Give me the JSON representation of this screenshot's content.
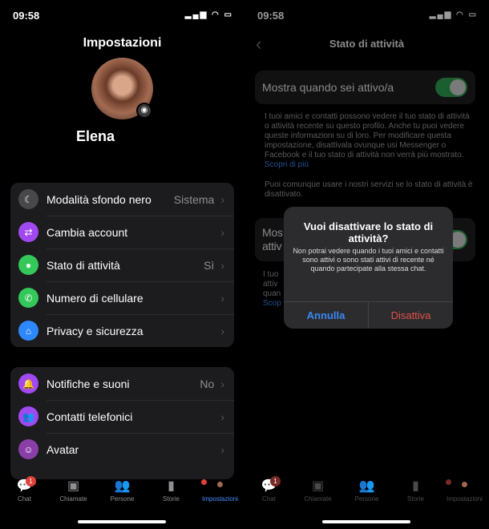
{
  "status": {
    "time": "09:58",
    "icons": "▂▄▆ ◠ ▭"
  },
  "left": {
    "title": "Impostazioni",
    "profile_name": "Elena",
    "group1": [
      {
        "label": "Modalità sfondo nero",
        "value": "Sistema",
        "icon": "moon-icon",
        "color": "#48484a",
        "glyph": "☾"
      },
      {
        "label": "Cambia account",
        "value": "",
        "icon": "switch-account-icon",
        "color": "#a149f1",
        "glyph": "⇄"
      },
      {
        "label": "Stato di attività",
        "value": "Sì",
        "icon": "active-status-icon",
        "color": "#34c759",
        "glyph": "●"
      },
      {
        "label": "Numero di cellulare",
        "value": "",
        "icon": "phone-icon",
        "color": "#34c759",
        "glyph": "✆"
      },
      {
        "label": "Privacy e sicurezza",
        "value": "",
        "icon": "home-shield-icon",
        "color": "#2d88ff",
        "glyph": "⌂"
      }
    ],
    "group2": [
      {
        "label": "Notifiche e suoni",
        "value": "No",
        "icon": "bell-icon",
        "color": "#a149f1",
        "glyph": "🔔"
      },
      {
        "label": "Contatti telefonici",
        "value": "",
        "icon": "contacts-icon",
        "color": "#a149f1",
        "glyph": "👥"
      },
      {
        "label": "Avatar",
        "value": "",
        "icon": "avatar-icon",
        "color": "#8a3fa8",
        "glyph": "☺"
      }
    ]
  },
  "tabs": [
    {
      "label": "Chat",
      "icon": "chat-icon",
      "glyph": "💬",
      "badge": "1"
    },
    {
      "label": "Chiamate",
      "icon": "video-icon",
      "glyph": "▣"
    },
    {
      "label": "Persone",
      "icon": "people-icon",
      "glyph": "👥"
    },
    {
      "label": "Storie",
      "icon": "stories-icon",
      "glyph": "▮"
    },
    {
      "label": "Impostazioni",
      "icon": "profile-icon",
      "glyph": "●"
    }
  ],
  "right": {
    "title": "Stato di attività",
    "row1": "Mostra quando sei attivo/a",
    "footer1": "I tuoi amici e contatti possono vedere il tuo stato di attività o attività recente su questo profilo. Anche tu puoi vedere queste informazioni su di loro. Per modificare questa impostazione, disattivala ovunque usi Messenger o Facebook e il tuo stato di attività non verrà più mostrato.",
    "footer1_link": "Scopri di più",
    "footer2": "Puoi comunque usare i nostri servizi se lo stato di attività è disattivato.",
    "row2_partial": "Mos attiv",
    "footer3_partial": "I tuo attiv quan",
    "footer3_link_partial": "Scop",
    "dialog": {
      "title": "Vuoi disattivare lo stato di attività?",
      "message": "Non potrai vedere quando i tuoi amici e contatti sono attivi o sono stati attivi di recente né quando partecipate alla stessa chat.",
      "cancel": "Annulla",
      "confirm": "Disattiva"
    }
  },
  "colors": {
    "accent": "#4a8cff",
    "toggle": "#30a452",
    "destructive": "#e0504a"
  }
}
